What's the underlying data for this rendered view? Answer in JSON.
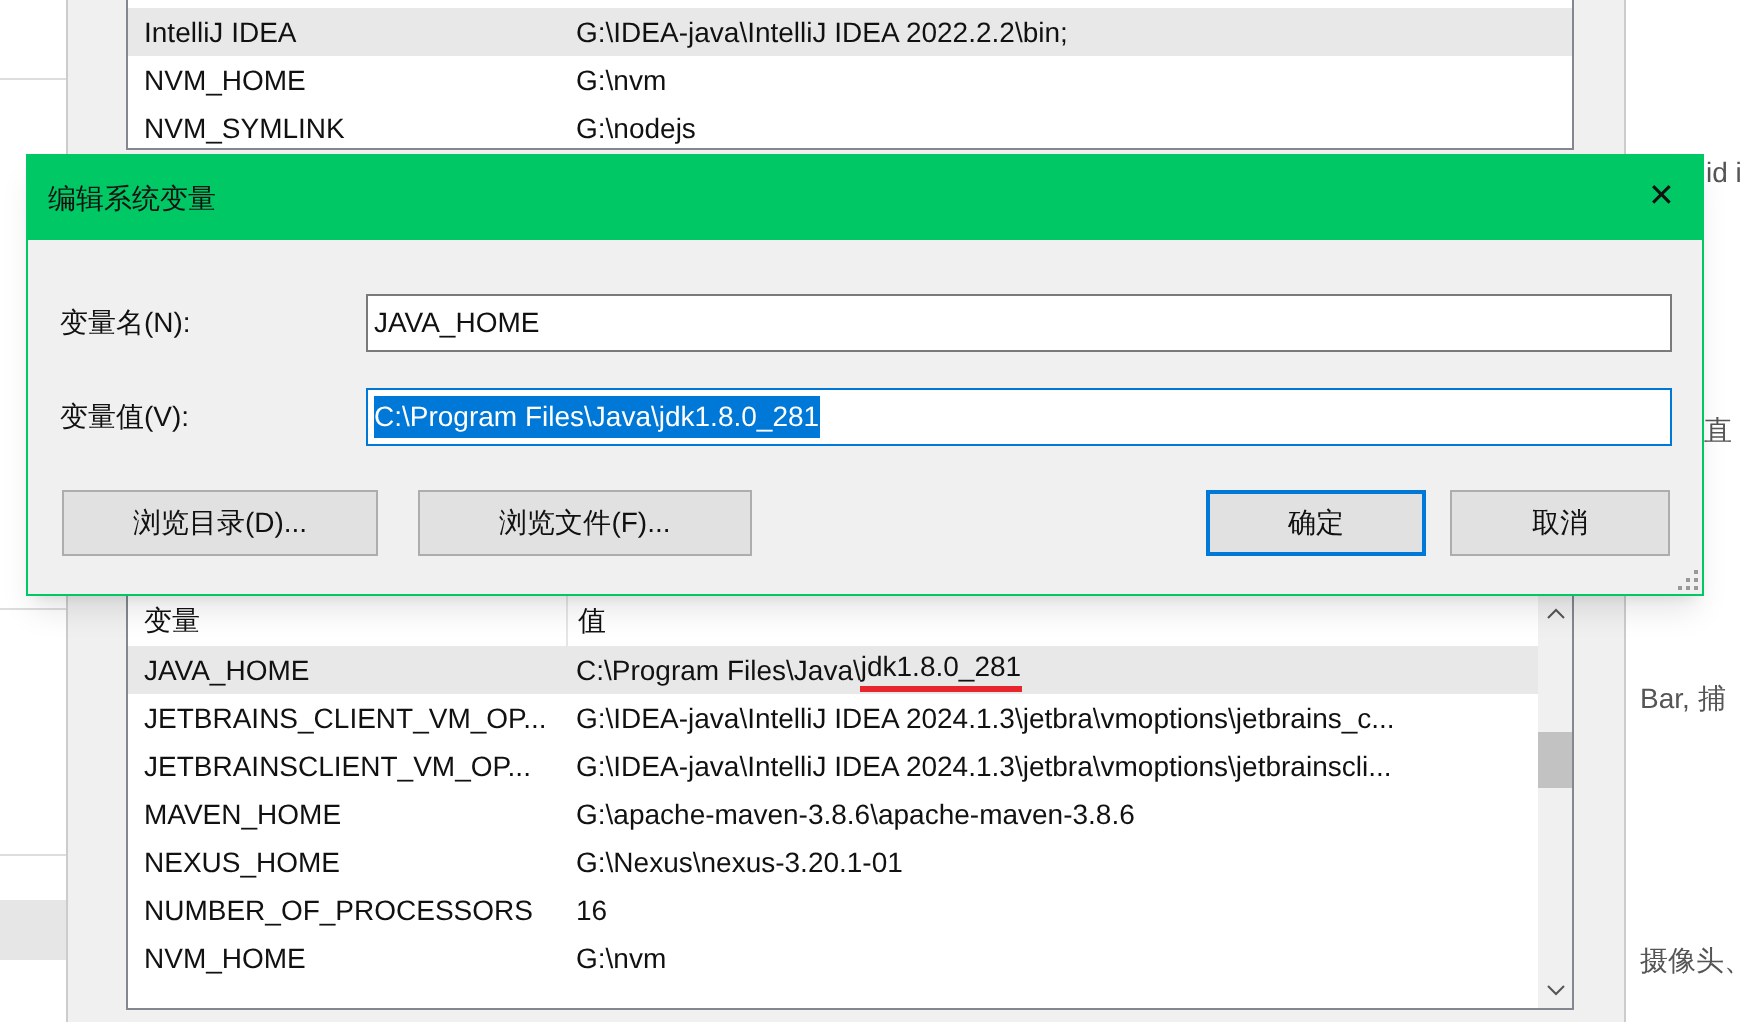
{
  "background_page": {
    "snippets": [
      "id i",
      "直",
      "Bar, 捕",
      "摄像头、"
    ]
  },
  "top_list": {
    "rows": [
      {
        "name": "IntelliJ IDEA",
        "value": "G:\\IDEA-java\\IntelliJ IDEA 2022.2.2\\bin;",
        "selected": true
      },
      {
        "name": "NVM_HOME",
        "value": "G:\\nvm",
        "selected": false
      },
      {
        "name": "NVM_SYMLINK",
        "value": "G:\\nodejs",
        "selected": false
      }
    ]
  },
  "dialog": {
    "title": "编辑系统变量",
    "close": "✕",
    "fields": [
      {
        "label": "变量名(N):",
        "value": "JAVA_HOME",
        "text_selected": false
      },
      {
        "label": "变量值(V):",
        "value": "C:\\Program Files\\Java\\jdk1.8.0_281",
        "text_selected": true
      }
    ],
    "buttons": [
      {
        "label": "浏览目录(D)...",
        "default": false
      },
      {
        "label": "浏览文件(F)...",
        "default": false
      },
      {
        "label": "确定",
        "default": true
      },
      {
        "label": "取消",
        "default": false
      }
    ]
  },
  "system_variables": {
    "columns": [
      "变量",
      "值"
    ],
    "rows": [
      {
        "name": "JAVA_HOME",
        "value": "C:\\Program Files\\Java\\",
        "value_marked": "jdk1.8.0_281",
        "selected": true
      },
      {
        "name": "JETBRAINS_CLIENT_VM_OP...",
        "value": "G:\\IDEA-java\\IntelliJ IDEA 2024.1.3\\jetbra\\vmoptions\\jetbrains_c...",
        "selected": false
      },
      {
        "name": "JETBRAINSCLIENT_VM_OP...",
        "value": "G:\\IDEA-java\\IntelliJ IDEA 2024.1.3\\jetbra\\vmoptions\\jetbrainscli...",
        "selected": false
      },
      {
        "name": "MAVEN_HOME",
        "value": "G:\\apache-maven-3.8.6\\apache-maven-3.8.6",
        "selected": false
      },
      {
        "name": "NEXUS_HOME",
        "value": "G:\\Nexus\\nexus-3.20.1-01",
        "selected": false
      },
      {
        "name": "NUMBER_OF_PROCESSORS",
        "value": "16",
        "selected": false
      },
      {
        "name": "NVM_HOME",
        "value": "G:\\nvm",
        "selected": false
      }
    ]
  }
}
